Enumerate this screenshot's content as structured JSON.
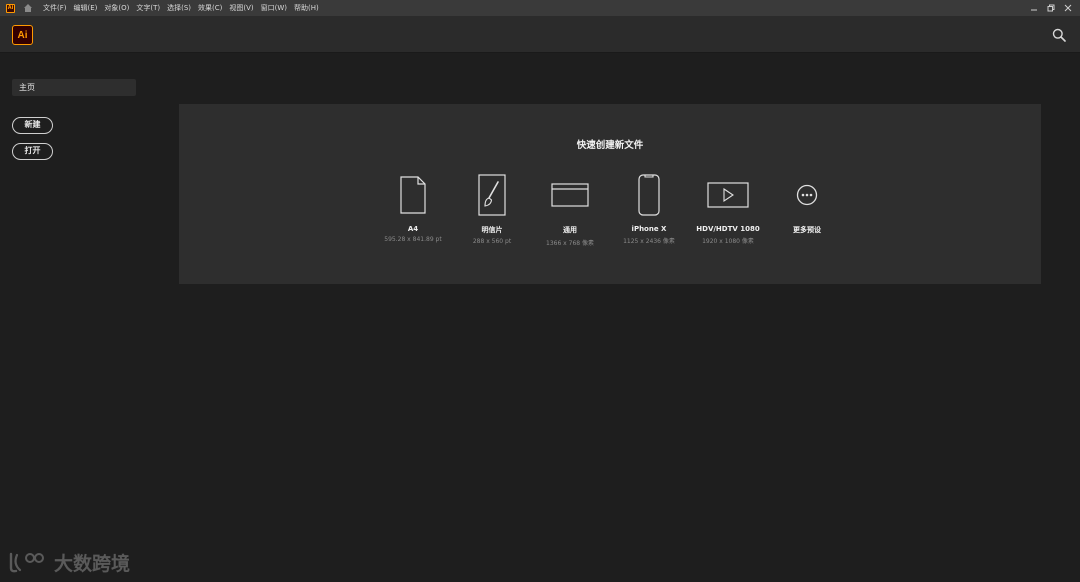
{
  "menubar": {
    "app_badge": "Ai",
    "items": [
      "文件(F)",
      "编辑(E)",
      "对象(O)",
      "文字(T)",
      "选择(S)",
      "效果(C)",
      "视图(V)",
      "窗口(W)",
      "帮助(H)"
    ]
  },
  "header": {
    "logo_text": "Ai"
  },
  "sidebar": {
    "home_label": "主页",
    "new_label": "新建",
    "open_label": "打开"
  },
  "quick_create": {
    "title": "快速创建新文件",
    "presets": [
      {
        "name": "A4",
        "dims": "595.28 x 841.89 pt",
        "icon": "document-icon"
      },
      {
        "name": "明信片",
        "dims": "288 x 560 pt",
        "icon": "brush-card-icon"
      },
      {
        "name": "通用",
        "dims": "1366 x 768 像素",
        "icon": "browser-window-icon"
      },
      {
        "name": "iPhone X",
        "dims": "1125 x 2436 像素",
        "icon": "phone-icon"
      },
      {
        "name": "HDV/HDTV 1080",
        "dims": "1920 x 1080 像素",
        "icon": "video-play-icon"
      },
      {
        "name": "更多预设",
        "dims": "",
        "icon": "more-dots-icon"
      }
    ]
  },
  "watermark": {
    "text": "大数跨境"
  },
  "colors": {
    "brand_orange": "#ff9a00",
    "brand_dark": "#330000",
    "background": "#1e1e1e",
    "panel": "#2e2e2e"
  }
}
